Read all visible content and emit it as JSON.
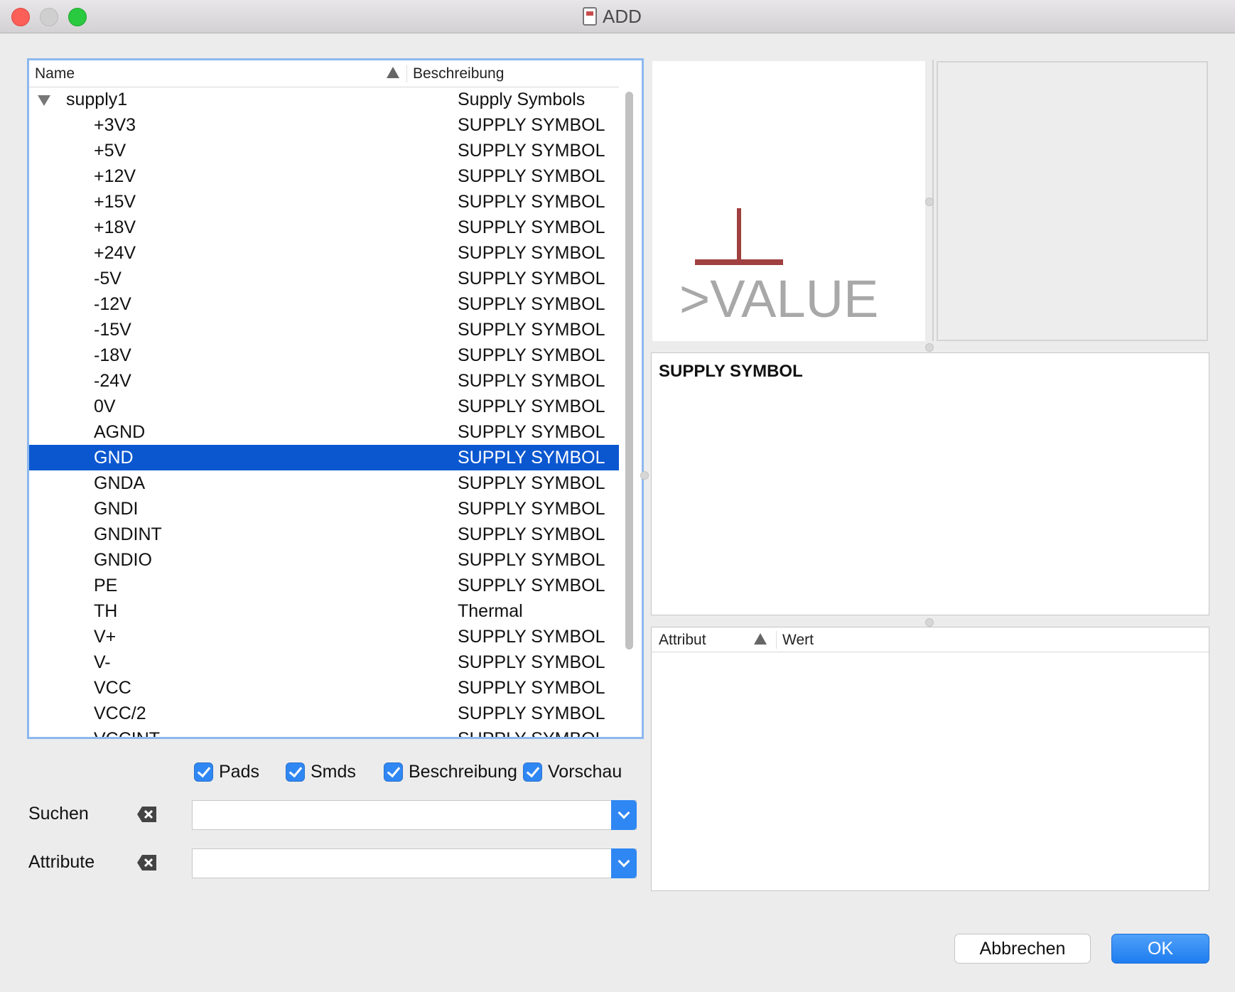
{
  "window": {
    "title": "ADD"
  },
  "tree": {
    "columns": {
      "name": "Name",
      "description": "Beschreibung"
    },
    "group": {
      "name": "supply1",
      "description": "Supply Symbols"
    },
    "items": [
      {
        "name": "+3V3",
        "description": "SUPPLY SYMBOL"
      },
      {
        "name": "+5V",
        "description": "SUPPLY SYMBOL"
      },
      {
        "name": "+12V",
        "description": "SUPPLY SYMBOL"
      },
      {
        "name": "+15V",
        "description": "SUPPLY SYMBOL"
      },
      {
        "name": "+18V",
        "description": "SUPPLY SYMBOL"
      },
      {
        "name": "+24V",
        "description": "SUPPLY SYMBOL"
      },
      {
        "name": "-5V",
        "description": "SUPPLY SYMBOL"
      },
      {
        "name": "-12V",
        "description": "SUPPLY SYMBOL"
      },
      {
        "name": "-15V",
        "description": "SUPPLY SYMBOL"
      },
      {
        "name": "-18V",
        "description": "SUPPLY SYMBOL"
      },
      {
        "name": "-24V",
        "description": "SUPPLY SYMBOL"
      },
      {
        "name": "0V",
        "description": "SUPPLY SYMBOL"
      },
      {
        "name": "AGND",
        "description": "SUPPLY SYMBOL"
      },
      {
        "name": "GND",
        "description": "SUPPLY SYMBOL",
        "selected": true
      },
      {
        "name": "GNDA",
        "description": "SUPPLY SYMBOL"
      },
      {
        "name": "GNDI",
        "description": "SUPPLY SYMBOL"
      },
      {
        "name": "GNDINT",
        "description": "SUPPLY SYMBOL"
      },
      {
        "name": "GNDIO",
        "description": "SUPPLY SYMBOL"
      },
      {
        "name": "PE",
        "description": "SUPPLY SYMBOL"
      },
      {
        "name": "TH",
        "description": "Thermal"
      },
      {
        "name": "V+",
        "description": "SUPPLY SYMBOL"
      },
      {
        "name": "V-",
        "description": "SUPPLY SYMBOL"
      },
      {
        "name": "VCC",
        "description": "SUPPLY SYMBOL"
      },
      {
        "name": "VCC/2",
        "description": "SUPPLY SYMBOL"
      },
      {
        "name": "VCCINT",
        "description": "SUPPLY SYMBOL"
      }
    ]
  },
  "preview": {
    "symbol_text": ">VALUE",
    "symbol_color": "#a04040",
    "text_color": "#a8a8a8"
  },
  "description_panel": {
    "title": "SUPPLY SYMBOL"
  },
  "attributes": {
    "columns": {
      "attribute": "Attribut",
      "value": "Wert"
    }
  },
  "options": {
    "pads": "Pads",
    "smds": "Smds",
    "description": "Beschreibung",
    "preview": "Vorschau"
  },
  "filters": {
    "search_label": "Suchen",
    "search_value": "",
    "attribute_label": "Attribute",
    "attribute_value": ""
  },
  "buttons": {
    "cancel": "Abbrechen",
    "ok": "OK"
  },
  "colors": {
    "selection": "#0b57d0",
    "accent": "#2f87f3"
  }
}
